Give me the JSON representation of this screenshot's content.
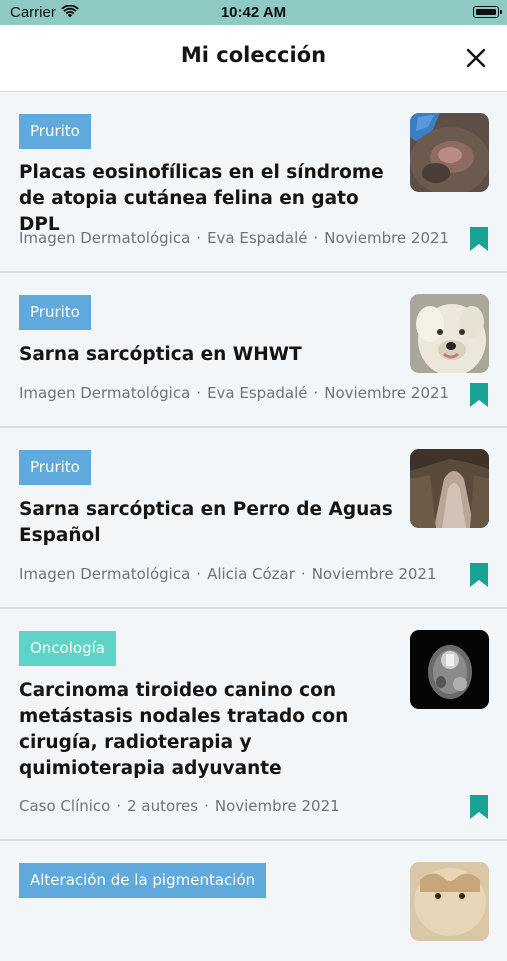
{
  "status_bar": {
    "carrier": "Carrier",
    "time": "10:42 AM"
  },
  "header": {
    "title": "Mi colección"
  },
  "colors": {
    "accent": "#1aa394",
    "tag_blue": "#5fa9dc",
    "tag_teal": "#5fd3c6",
    "status_bar": "#8fc9c4"
  },
  "items": [
    {
      "tag": "Prurito",
      "title": "Placas eosinofílicas en el síndrome de atopia cutánea felina en gato DPL",
      "meta": [
        "Imagen Dermatológica",
        "Eva Espadalé",
        "Noviembre 2021"
      ],
      "thumbnail": "cat-skin-lesion-photo",
      "bookmark_icon": "bookmark-icon"
    },
    {
      "tag": "Prurito",
      "title": "Sarna sarcóptica en WHWT",
      "meta": [
        "Imagen Dermatológica",
        "Eva Espadalé",
        "Noviembre 2021"
      ],
      "thumbnail": "white-terrier-photo",
      "bookmark_icon": "bookmark-icon"
    },
    {
      "tag": "Prurito",
      "title": "Sarna sarcóptica en Perro de Aguas Español",
      "meta": [
        "Imagen Dermatológica",
        "Alicia Cózar",
        "Noviembre 2021"
      ],
      "thumbnail": "dog-ear-photo",
      "bookmark_icon": "bookmark-icon"
    },
    {
      "tag": "Oncología",
      "title": "Carcinoma tiroideo canino con metástasis nodales tratado con cirugía, radioterapia y quimioterapia adyuvante",
      "meta": [
        "Caso Clínico",
        "2 autores",
        "Noviembre 2021"
      ],
      "thumbnail": "ct-scan-image",
      "bookmark_icon": "bookmark-icon"
    },
    {
      "tag": "Alteración de la pigmentación",
      "title": "",
      "meta": [],
      "thumbnail": "dog-face-photo"
    }
  ]
}
